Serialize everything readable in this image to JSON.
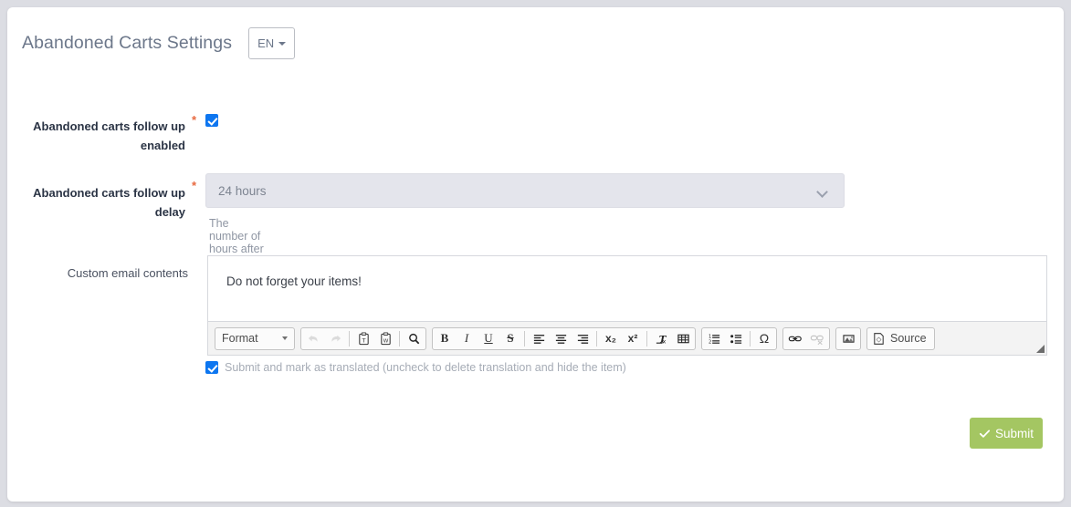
{
  "header": {
    "title": "Abandoned Carts Settings",
    "language_button": "EN",
    "language_caret_icon": "caret-down-icon"
  },
  "form": {
    "rows": [
      {
        "label": "Abandoned carts follow up enabled",
        "required_marker": "*",
        "control": "checkbox",
        "checked": true
      },
      {
        "label": "Abandoned carts follow up delay",
        "required_marker": "*",
        "control": "select",
        "value": "24 hours",
        "help": "The number of hours after the cart is considered as abandoned",
        "chevron_icon": "chevron-down-icon"
      },
      {
        "label": "Custom email contents",
        "required_marker": "",
        "control": "rich-text-editor",
        "content": "Do not forget your items!"
      }
    ]
  },
  "editor": {
    "format_label": "Format",
    "format_caret_icon": "caret-down-icon",
    "source_label": "Source",
    "tools": {
      "undo": "undo-icon",
      "redo": "redo-icon",
      "paste_text": "paste-as-plain-text-icon",
      "paste_word": "paste-from-word-icon",
      "find": "search-icon",
      "bold": "B",
      "italic": "I",
      "underline": "U",
      "strike": "S",
      "align_left": "align-left-icon",
      "align_center": "align-center-icon",
      "align_right": "align-right-icon",
      "subscript": "x₂",
      "superscript": "x²",
      "remove_format": "remove-format-icon",
      "table": "table-icon",
      "numbered_list": "numbered-list-icon",
      "bulleted_list": "bulleted-list-icon",
      "special_char": "Ω",
      "link": "link-icon",
      "unlink": "unlink-icon",
      "image": "image-icon",
      "source": "source-icon",
      "resize_grip": "resize-grip-icon"
    }
  },
  "translated": {
    "label": "Submit and mark as translated (uncheck to delete translation and hide the item)",
    "checked": true
  },
  "footer": {
    "submit_label": "Submit",
    "submit_icon": "check-icon"
  },
  "colors": {
    "accent_blue": "#0d76f0",
    "submit_green": "#a4c662",
    "required_orange": "#e8693f",
    "page_background": "#dcdde3"
  }
}
